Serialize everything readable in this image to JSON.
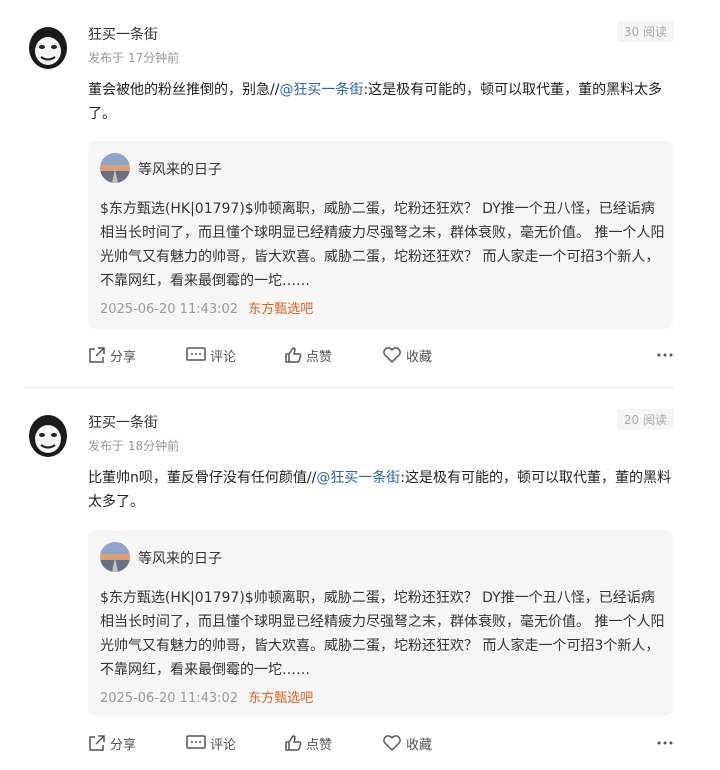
{
  "posts": [
    {
      "author": "狂买一条街",
      "time": "发布于 17分钟前",
      "reads": "30 阅读",
      "body_prefix": "董会被他的粉丝推倒的，别急//",
      "mention": "@狂买一条街",
      "body_suffix": ":这是极有可能的，顿可以取代董，董的黑料太多了。",
      "quote": {
        "name": "等风来的日子",
        "text": "$东方甄选(HK|01797)$帅顿离职，威胁二蛋，坨粉还狂欢？ DY推一个丑八怪，已经诟病相当长时间了，而且懂个球明显已经精疲力尽强弩之末，群体衰败，毫无价值。 推一个人阳光帅气又有魅力的帅哥，皆大欢喜。威胁二蛋，坨粉还狂欢？ 而人家走一个可招3个新人，不靠网红，看来最倒霉的一坨……",
        "date": "2025-06-20 11:43:02",
        "tag": "东方甄选吧"
      },
      "actions": {
        "share": "分享",
        "comment": "评论",
        "like": "点赞",
        "collect": "收藏"
      }
    },
    {
      "author": "狂买一条街",
      "time": "发布于 18分钟前",
      "reads": "20 阅读",
      "body_prefix": "比董帅n呗，董反骨仔没有任何颜值//",
      "mention": "@狂买一条街",
      "body_suffix": ":这是极有可能的，顿可以取代董，董的黑料太多了。",
      "quote": {
        "name": "等风来的日子",
        "text": "$东方甄选(HK|01797)$帅顿离职，威胁二蛋，坨粉还狂欢？ DY推一个丑八怪，已经诟病相当长时间了，而且懂个球明显已经精疲力尽强弩之末，群体衰败，毫无价值。 推一个人阳光帅气又有魅力的帅哥，皆大欢喜。威胁二蛋，坨粉还狂欢？ 而人家走一个可招3个新人，不靠网红，看来最倒霉的一坨……",
        "date": "2025-06-20 11:43:02",
        "tag": "东方甄选吧"
      },
      "actions": {
        "share": "分享",
        "comment": "评论",
        "like": "点赞",
        "collect": "收藏"
      }
    }
  ]
}
